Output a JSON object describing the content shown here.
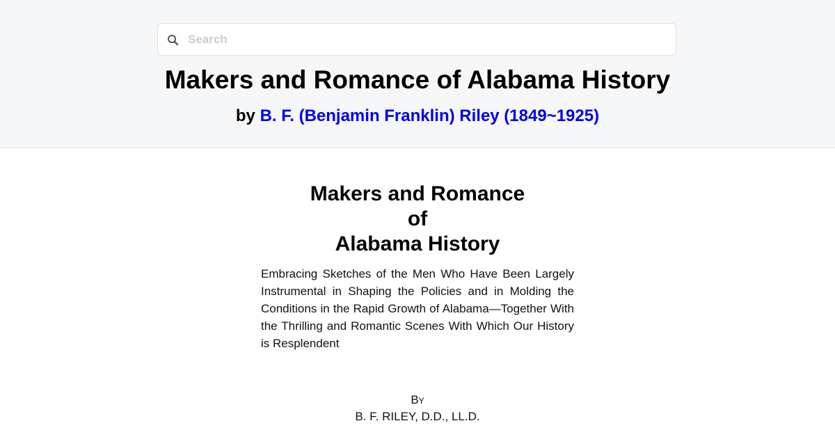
{
  "search": {
    "placeholder": "Search",
    "icon": "search-icon"
  },
  "header": {
    "title": "Makers and Romance of Alabama History",
    "by_prefix": "by",
    "author_link": "B. F. (Benjamin Franklin) Riley (1849~1925)",
    "link_color": "#0000ee",
    "background": "#f6f7f9"
  },
  "content": {
    "title_lines": [
      "Makers and Romance",
      "of",
      "Alabama History"
    ],
    "subtitle": "Embracing Sketches of the Men Who Have Been Largely Instrumental in Shaping the Policies and in Molding the Conditions in the Rapid Growth of Alabama—Together With the Thrilling and Romantic Scenes With Which Our History is Resplendent",
    "by_label": "By",
    "author_credit": "B. F. RILEY, D.D., LL.D."
  }
}
